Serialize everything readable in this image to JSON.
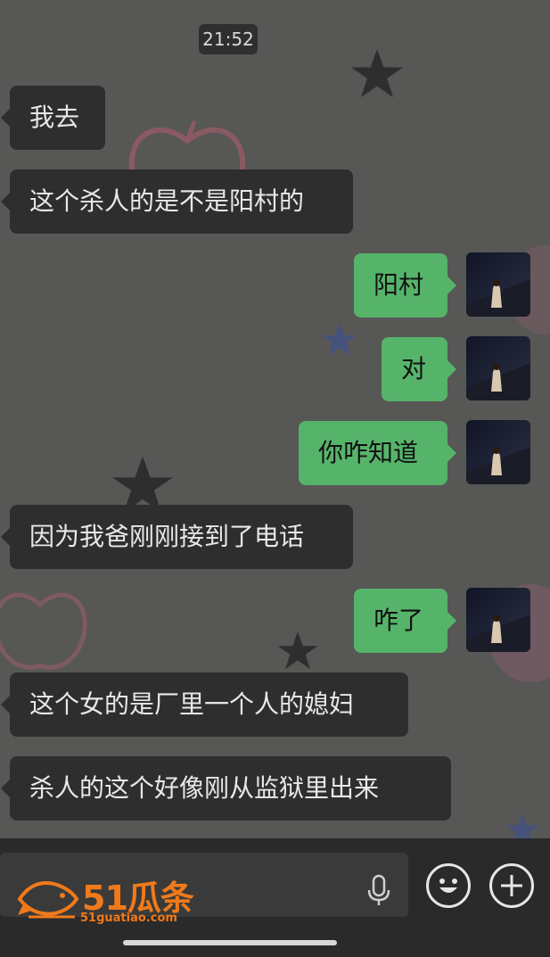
{
  "timestamp": "21:52",
  "messages": [
    {
      "side": "in",
      "text": "我去"
    },
    {
      "side": "in",
      "text": "这个杀人的是不是阳村的"
    },
    {
      "side": "out",
      "text": "阳村"
    },
    {
      "side": "out",
      "text": "对"
    },
    {
      "side": "out",
      "text": "你咋知道"
    },
    {
      "side": "in",
      "text": "因为我爸刚刚接到了电话"
    },
    {
      "side": "out",
      "text": "咋了"
    },
    {
      "side": "in",
      "text": "这个女的是厂里一个人的媳妇"
    },
    {
      "side": "in",
      "text": "杀人的这个好像刚从监狱里出来"
    }
  ],
  "input_bar": {
    "icons": [
      "voice-icon",
      "emoji-icon",
      "plus-icon"
    ]
  },
  "watermark": {
    "title": "51瓜条",
    "url": "51guatiao.com"
  },
  "colors": {
    "incoming_bubble": "#2e2e2e",
    "outgoing_bubble": "#56b46a",
    "background": "#575755",
    "watermark": "#f07a1a"
  }
}
